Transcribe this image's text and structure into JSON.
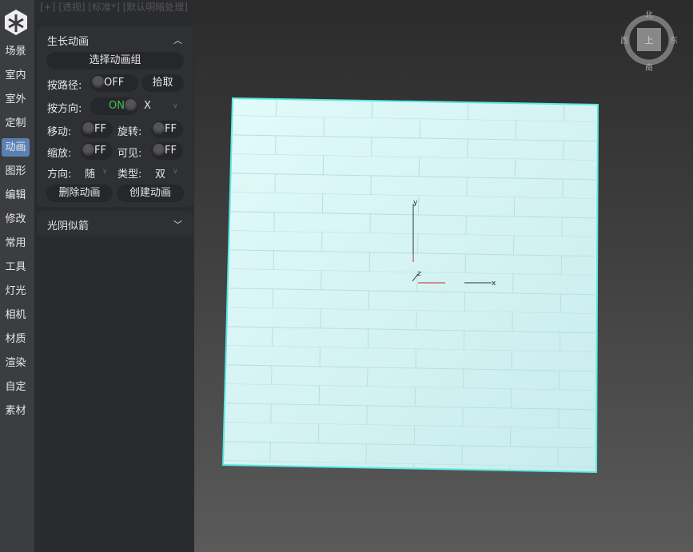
{
  "viewport_header": "[+] [透视] [标准*] [默认明暗处理]",
  "nav": {
    "items": [
      "场景",
      "室内",
      "室外",
      "定制",
      "动画",
      "图形",
      "编辑",
      "修改",
      "常用",
      "工具",
      "灯光",
      "相机",
      "材质",
      "渲染",
      "自定",
      "素材"
    ],
    "active": "动画"
  },
  "growth": {
    "title": "生长动画",
    "select_group": "选择动画组",
    "by_path_label": "按路径:",
    "by_path_state": "OFF",
    "pick": "拾取",
    "by_dir_label": "按方向:",
    "by_dir_state": "ON",
    "by_dir_axis": "X",
    "move_label": "移动:",
    "move_state": "FF",
    "rotate_label": "旋转:",
    "rotate_state": "FF",
    "scale_label": "缩放:",
    "scale_state": "FF",
    "visible_label": "可见:",
    "visible_state": "FF",
    "direction_label": "方向:",
    "direction_value": "随",
    "type_label": "类型:",
    "type_value": "双",
    "delete": "删除动画",
    "create": "创建动画"
  },
  "light_shadow": {
    "title": "光阴似箭"
  },
  "compass": {
    "n": "北",
    "s": "南",
    "e": "东",
    "w": "西",
    "face": "上"
  },
  "axes": {
    "x": "x",
    "y": "y",
    "z": "z"
  },
  "colors": {
    "accent": "#5b80b4",
    "on": "#3ec25a",
    "wall": "#d6f4f4",
    "wall_edge": "#59e8e0"
  }
}
